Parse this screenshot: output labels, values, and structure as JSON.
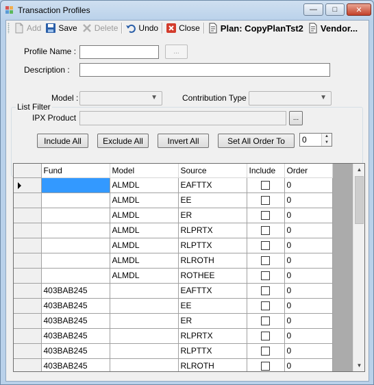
{
  "window": {
    "title": "Transaction Profiles",
    "min_glyph": "—",
    "max_glyph": "□",
    "close_glyph": "✕"
  },
  "toolbar": {
    "add": "Add",
    "save": "Save",
    "delete": "Delete",
    "undo": "Undo",
    "close": "Close",
    "plan": "Plan: CopyPlanTst2",
    "vendor": "Vendor..."
  },
  "form": {
    "profile_name_label": "Profile Name :",
    "profile_name_value": "",
    "profile_browse": "...",
    "description_label": "Description :",
    "description_value": "",
    "list_filter_title": "List Filter",
    "model_label": "Model :",
    "model_value": "",
    "contribution_type_label": "Contribution Type :",
    "contribution_type_value": "",
    "ipx_product_label": "IPX Product",
    "ipx_product_value": "",
    "ipx_browse": "...",
    "include_all": "Include All",
    "exclude_all": "Exclude All",
    "invert_all": "Invert All",
    "set_all_order_to": "Set All Order To",
    "order_value": "0"
  },
  "grid": {
    "columns": [
      "Fund",
      "Model",
      "Source",
      "Include",
      "Order"
    ],
    "rows": [
      {
        "fund": "",
        "model": "ALMDL",
        "source": "EAFTTX",
        "include": false,
        "order": "0",
        "current": true
      },
      {
        "fund": "",
        "model": "ALMDL",
        "source": "EE",
        "include": false,
        "order": "0"
      },
      {
        "fund": "",
        "model": "ALMDL",
        "source": "ER",
        "include": false,
        "order": "0"
      },
      {
        "fund": "",
        "model": "ALMDL",
        "source": "RLPRTX",
        "include": false,
        "order": "0"
      },
      {
        "fund": "",
        "model": "ALMDL",
        "source": "RLPTTX",
        "include": false,
        "order": "0"
      },
      {
        "fund": "",
        "model": "ALMDL",
        "source": "RLROTH",
        "include": false,
        "order": "0"
      },
      {
        "fund": "",
        "model": "ALMDL",
        "source": "ROTHEE",
        "include": false,
        "order": "0"
      },
      {
        "fund": "403BAB245",
        "model": "",
        "source": "EAFTTX",
        "include": false,
        "order": "0"
      },
      {
        "fund": "403BAB245",
        "model": "",
        "source": "EE",
        "include": false,
        "order": "0"
      },
      {
        "fund": "403BAB245",
        "model": "",
        "source": "ER",
        "include": false,
        "order": "0"
      },
      {
        "fund": "403BAB245",
        "model": "",
        "source": "RLPRTX",
        "include": false,
        "order": "0"
      },
      {
        "fund": "403BAB245",
        "model": "",
        "source": "RLPTTX",
        "include": false,
        "order": "0"
      },
      {
        "fund": "403BAB245",
        "model": "",
        "source": "RLROTH",
        "include": false,
        "order": "0"
      }
    ]
  },
  "colors": {
    "selection": "#3399ff",
    "window_frame": "#b9d1ea",
    "client_bg": "#f0f0f0"
  }
}
